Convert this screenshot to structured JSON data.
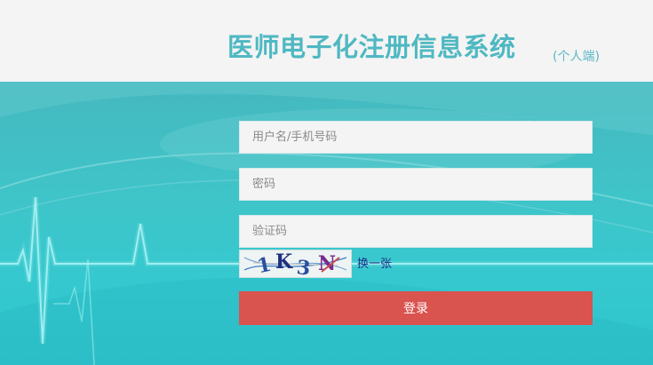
{
  "header": {
    "title": "医师电子化注册信息系统",
    "subtitle": "(个人端)"
  },
  "form": {
    "username_placeholder": "用户名/手机号码",
    "password_placeholder": "密码",
    "captcha_placeholder": "验证码",
    "captcha_text": "1K3N",
    "refresh_captcha_label": "换一张",
    "login_label": "登录"
  },
  "colors": {
    "brand": "#4fb8c2",
    "background_teal": "#3fc4c8",
    "login_button": "#d9534f",
    "link": "#1d2f86"
  }
}
